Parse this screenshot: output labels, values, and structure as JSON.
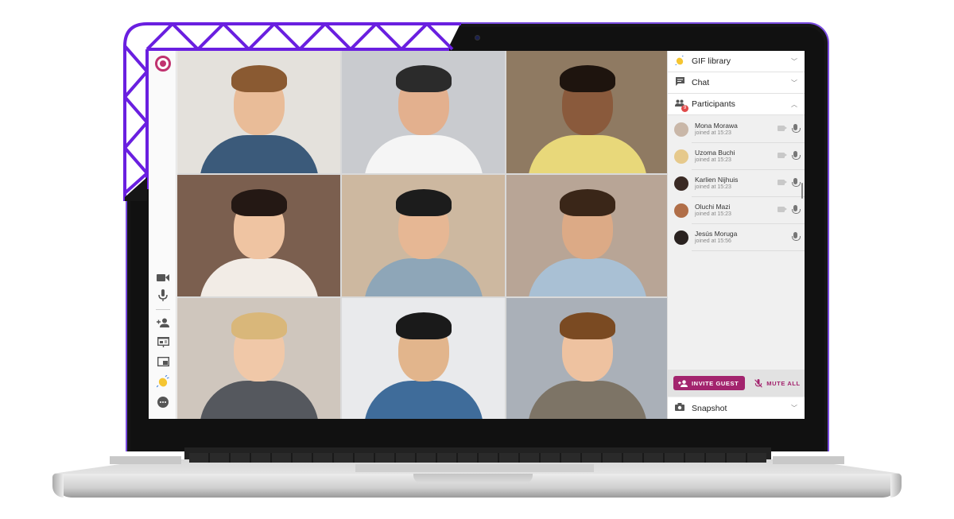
{
  "app": {
    "rail": {
      "items": [
        {
          "id": "camera",
          "icon": "video-camera-icon",
          "glyph": "■"
        },
        {
          "id": "microphone",
          "icon": "microphone-icon",
          "glyph": "🎙"
        },
        {
          "id": "add-participant",
          "icon": "add-person-icon",
          "glyph": "+👤"
        },
        {
          "id": "presentation",
          "icon": "presentation-icon",
          "glyph": "▤"
        },
        {
          "id": "screen-share",
          "icon": "screen-share-icon",
          "glyph": "⧉"
        },
        {
          "id": "reactions",
          "icon": "clapping-hands-icon",
          "glyph": "👏"
        },
        {
          "id": "more",
          "icon": "more-options-icon",
          "glyph": "⋯"
        }
      ]
    },
    "video_grid": {
      "tiles": [
        {
          "bg": "#e4e1dc",
          "hair": "#8a5a32",
          "skin": "#e9bc98",
          "shirt": "#3b5a7a"
        },
        {
          "bg": "#c9cbcf",
          "hair": "#2b2b2b",
          "skin": "#e3b08e",
          "shirt": "#f5f5f5"
        },
        {
          "bg": "#8f7a62",
          "hair": "#1e140e",
          "skin": "#8a5a3c",
          "shirt": "#e8d87a"
        },
        {
          "bg": "#7b5f4f",
          "hair": "#241814",
          "skin": "#efc4a2",
          "shirt": "#f2ece6"
        },
        {
          "bg": "#cdb8a0",
          "hair": "#1c1c1c",
          "skin": "#e6b794",
          "shirt": "#8ea6b8"
        },
        {
          "bg": "#b8a596",
          "hair": "#3a2618",
          "skin": "#dcaa86",
          "shirt": "#a9c0d4"
        },
        {
          "bg": "#cfc6bd",
          "hair": "#d9b77a",
          "skin": "#f0c8a8",
          "shirt": "#55585e"
        },
        {
          "bg": "#e9eaec",
          "hair": "#1a1a1a",
          "skin": "#e2b58c",
          "shirt": "#3f6c9a"
        },
        {
          "bg": "#aab0b8",
          "hair": "#7a4a22",
          "skin": "#eec2a0",
          "shirt": "#7d7466"
        }
      ]
    },
    "panel": {
      "sections": {
        "gif_library": {
          "label": "GIF library",
          "icon": "gif-library-icon",
          "state": "collapsed"
        },
        "chat": {
          "label": "Chat",
          "icon": "chat-icon",
          "state": "collapsed"
        },
        "participants": {
          "label": "Participants",
          "icon": "participants-icon",
          "badge": "9",
          "state": "expanded"
        },
        "snapshot": {
          "label": "Snapshot",
          "icon": "camera-icon",
          "state": "collapsed"
        }
      },
      "participants": [
        {
          "name": "Mona Morawa",
          "joined": "joined at 15:23",
          "camera": true,
          "avatar": "#c9b7a8"
        },
        {
          "name": "Uzoma Buchi",
          "joined": "joined at 15:23",
          "camera": true,
          "avatar": "#e6c98c"
        },
        {
          "name": "Karlien Nijhuis",
          "joined": "joined at 15:23",
          "camera": true,
          "avatar": "#3a2a24"
        },
        {
          "name": "Oluchi Mazi",
          "joined": "joined at 15:23",
          "camera": true,
          "avatar": "#b06e48"
        },
        {
          "name": "Jesús Moruga",
          "joined": "joined at 15:56",
          "camera": false,
          "avatar": "#2a2220"
        }
      ],
      "actions": {
        "invite_guest": "INVITE GUEST",
        "mute_all": "MUTE ALL"
      }
    },
    "colors": {
      "accent": "#a3246e",
      "logo": "#c0326f",
      "deco": "#6a1fe0"
    }
  }
}
